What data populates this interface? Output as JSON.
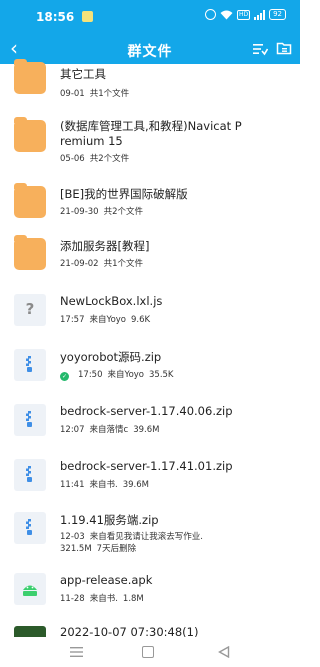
{
  "status": {
    "time": "18:56",
    "hd": "HD",
    "battery": "92"
  },
  "header": {
    "title": "群文件"
  },
  "files": [
    {
      "name": "其它工具",
      "meta": [
        "09-01",
        "共1个文件"
      ],
      "icon": "folder-icon"
    },
    {
      "name": "(数据库管理工具,和教程)Navicat P",
      "name2": "remium 15",
      "meta": [
        "05-06",
        "共2个文件"
      ],
      "icon": "folder-icon"
    },
    {
      "name": "[BE]我的世界国际破解版",
      "meta": [
        "21-09-30",
        "共2个文件"
      ],
      "icon": "folder-icon"
    },
    {
      "name": "添加服务器[教程]",
      "meta": [
        "21-09-02",
        "共1个文件"
      ],
      "icon": "folder-icon"
    },
    {
      "name": "NewLockBox.lxl.js",
      "meta": [
        "17:57",
        "来自Yoyo",
        "9.6K"
      ],
      "icon": "unknown-file-icon"
    },
    {
      "name": "yoyorobot源码.zip",
      "meta": [
        "17:50",
        "来自Yoyo",
        "35.5K"
      ],
      "icon": "zip-file-icon",
      "downloaded": true
    },
    {
      "name": "bedrock-server-1.17.40.06.zip",
      "meta": [
        "12:07",
        "来自落情c",
        "39.6M"
      ],
      "icon": "zip-file-icon"
    },
    {
      "name": "bedrock-server-1.17.41.01.zip",
      "meta": [
        "11:41",
        "来自书.",
        "39.6M"
      ],
      "icon": "zip-file-icon"
    },
    {
      "name": "1.19.41服务端.zip",
      "meta": [
        "12-03",
        "来自看见我请让我滚去写作业."
      ],
      "meta2": [
        "321.5M",
        "7天后删除"
      ],
      "icon": "zip-file-icon"
    },
    {
      "name": "app-release.apk",
      "meta": [
        "11-28",
        "来自书.",
        "1.8M"
      ],
      "icon": "apk-file-icon"
    },
    {
      "name": "2022-10-07 07:30:48(1)",
      "icon": "image-file-icon"
    }
  ],
  "colors": {
    "header": "#13a7e9",
    "folder": "#f7b05c",
    "zip": "#3f8fe6",
    "apk": "#3ccf6e"
  }
}
